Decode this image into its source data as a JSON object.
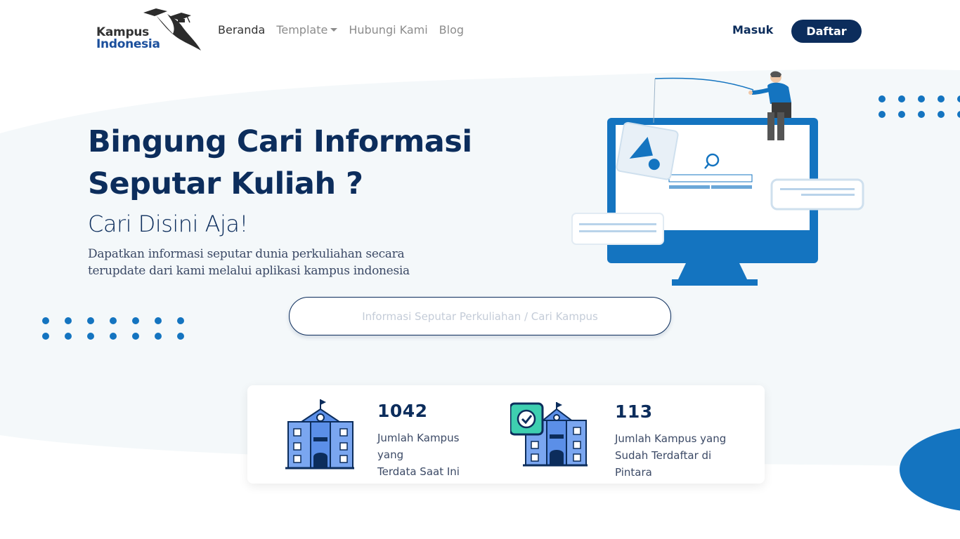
{
  "brand": {
    "logo_line1": "Kampus",
    "logo_line2": "Indonesia",
    "colors": {
      "navy": "#0c2d5c",
      "blue": "#1474c0",
      "light_bg": "#f4f8fa"
    }
  },
  "nav": {
    "links": [
      {
        "label": "Beranda",
        "active": true
      },
      {
        "label": "Template",
        "dropdown": true
      },
      {
        "label": "Hubungi Kami"
      },
      {
        "label": "Blog"
      }
    ],
    "login_label": "Masuk",
    "register_label": "Daftar"
  },
  "hero": {
    "title_line1": "Bingung Cari Informasi",
    "title_line2": "Seputar Kuliah ?",
    "subtitle": "Cari Disini Aja!",
    "description_line1": "Dapatkan informasi seputar dunia perkuliahan secara",
    "description_line2": "terupdate dari kami melalui aplikasi kampus indonesia"
  },
  "search": {
    "placeholder": "Informasi Seputar Perkuliahan / Cari Kampus",
    "value": ""
  },
  "stats": [
    {
      "icon": "university-building-icon",
      "value": "1042",
      "label_line1": "Jumlah Kampus",
      "label_line2": "yang",
      "label_line3": "Terdata Saat Ini"
    },
    {
      "icon": "verified-university-icon",
      "value": "113",
      "label_line1": "Jumlah Kampus yang",
      "label_line2": "Sudah Terdaftar di",
      "label_line3": "Pintara"
    }
  ]
}
